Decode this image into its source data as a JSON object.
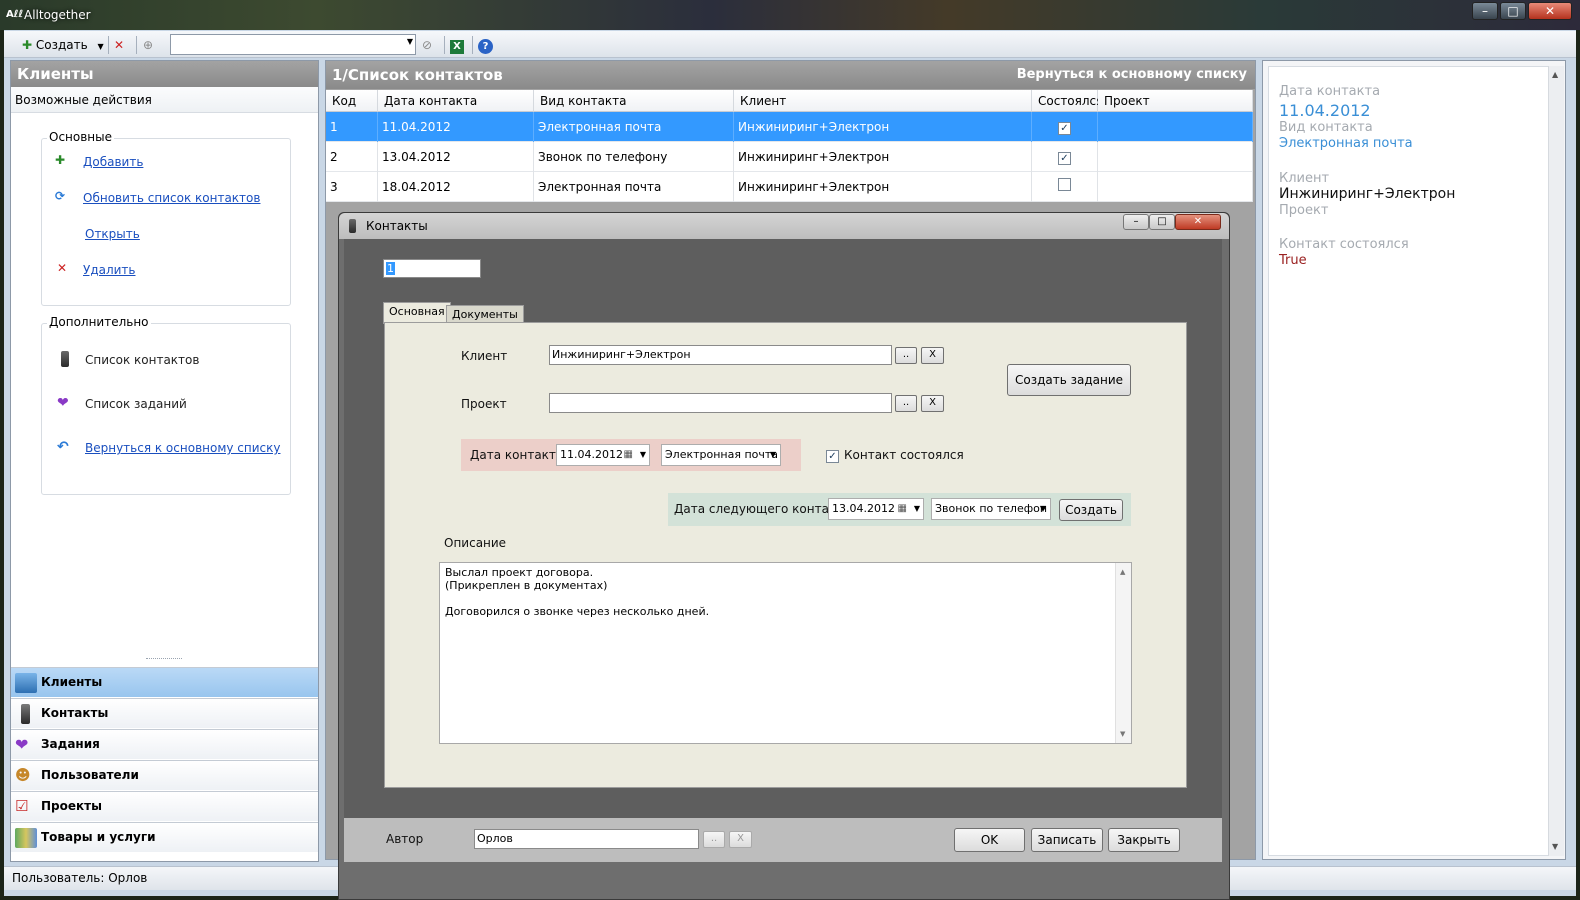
{
  "window": {
    "title": "Alltogether",
    "app_badge": "Aℓℓ"
  },
  "toolbar": {
    "create_label": "Создать",
    "search_value": ""
  },
  "left_panel": {
    "title": "Клиенты",
    "actions_caption": "Возможные действия",
    "main_group": {
      "title": "Основные",
      "items": [
        "Добавить",
        "Обновить список контактов",
        "Открыть",
        "Удалить"
      ]
    },
    "extra_group": {
      "title": "Дополнительно",
      "items": [
        "Список контактов",
        "Список заданий",
        "Вернуться к основному списку"
      ]
    },
    "nav": [
      "Клиенты",
      "Контакты",
      "Задания",
      "Пользователи",
      "Проекты",
      "Товары и услуги"
    ]
  },
  "center": {
    "title": "1/Список контактов",
    "back_link": "Вернуться к основному списку",
    "columns": [
      "Код",
      "Дата контакта",
      "Вид контакта",
      "Клиент",
      "Состоялся",
      "Проект"
    ],
    "rows": [
      {
        "code": "1",
        "date": "11.04.2012",
        "kind": "Электронная почта",
        "client": "Инжиниринг+Электрон",
        "done": true,
        "project": ""
      },
      {
        "code": "2",
        "date": "13.04.2012",
        "kind": "Звонок по телефону",
        "client": "Инжиниринг+Электрон",
        "done": true,
        "project": ""
      },
      {
        "code": "3",
        "date": "18.04.2012",
        "kind": "Электронная почта",
        "client": "Инжиниринг+Электрон",
        "done": false,
        "project": ""
      }
    ]
  },
  "right_panel": {
    "date_label": "Дата контакта",
    "date_value": "11.04.2012",
    "kind_label": "Вид контакта",
    "kind_value": "Электронная почта",
    "client_label": "Клиент",
    "client_value": "Инжиниринг+Электрон",
    "project_label": "Проект",
    "done_label": "Контакт состоялся",
    "done_value": "True"
  },
  "dialog": {
    "title": "Контакты",
    "code_value": "1",
    "tabs": [
      "Основная",
      "Документы"
    ],
    "client_label": "Клиент",
    "client_value": "Инжиниринг+Электрон",
    "project_label": "Проект",
    "project_value": "",
    "dots": "..",
    "clear": "X",
    "create_task": "Создать задание",
    "contact_date_label": "Дата контакта",
    "contact_date_value": "11.04.2012",
    "contact_kind_value": "Электронная почта",
    "contact_done_label": "Контакт состоялся",
    "next_date_label": "Дата следующего контакта",
    "next_date_value": "13.04.2012",
    "next_kind_value": "Звонок по телефон",
    "create_label": "Создать",
    "description_label": "Описание",
    "description_lines": [
      "Выслал проект договора.",
      "(Прикреплен в документах)",
      "",
      "Договорился о звонке через несколько дней."
    ],
    "author_label": "Автор",
    "author_value": "Орлов",
    "ok": "OK",
    "save": "Записать",
    "close": "Закрыть"
  },
  "status": {
    "user_text": "Пользователь: Орлов"
  }
}
